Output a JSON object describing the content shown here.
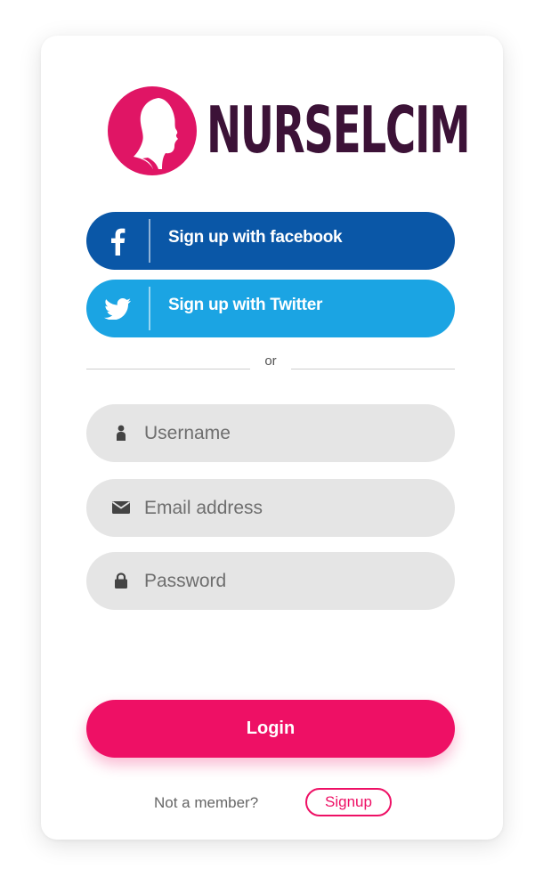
{
  "brand": {
    "name": "NURSELCIM",
    "primary_color": "#ee1065",
    "dark_color": "#3c1237",
    "logo_icon": "woman-profile-icon"
  },
  "social": {
    "facebook": {
      "label": "Sign up with facebook",
      "icon": "facebook-icon",
      "color": "#0a57a7"
    },
    "twitter": {
      "label": "Sign up with Twitter",
      "icon": "twitter-icon",
      "color": "#1ba4e3"
    }
  },
  "divider": {
    "text": "or"
  },
  "form": {
    "username": {
      "placeholder": "Username",
      "icon": "user-icon",
      "value": ""
    },
    "email": {
      "placeholder": "Email address",
      "icon": "envelope-icon",
      "value": ""
    },
    "password": {
      "placeholder": "Password",
      "icon": "lock-icon",
      "value": ""
    }
  },
  "login_button": {
    "label": "Login"
  },
  "footer": {
    "question": "Not a member?",
    "signup_label": "Signup"
  }
}
